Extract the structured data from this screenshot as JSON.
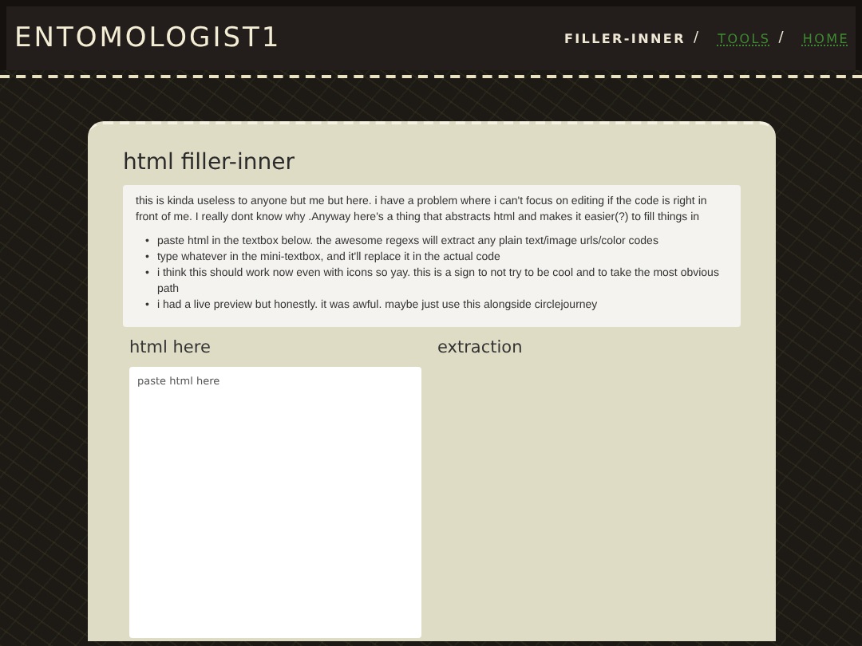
{
  "site_title": "ENTOMOLOGIST1",
  "nav": [
    {
      "label": "FILLER-INNER",
      "selected": true
    },
    {
      "label": "TOOLS",
      "selected": false
    },
    {
      "label": "HOME",
      "selected": false
    }
  ],
  "nav_separator": "/",
  "bullet_marker": "•",
  "page_title": "html filler-inner",
  "intro": "this is kinda useless to anyone but me but here. i have a problem where i can't focus on editing if the code is right in front of me. I really dont know why .Anyway here's a thing that abstracts html and makes it easier(?) to fill things in",
  "bullets": [
    "paste html in the textbox below. the awesome regexs will extract any plain text/image urls/color codes",
    "type whatever in the mini-textbox, and it'll replace it in the actual code",
    "i think this should work now even with icons so yay. this is a sign to not try to be cool and to take the most obvious path",
    "i had a live preview but honestly. it was awful. maybe just use this alongside circlejourney"
  ],
  "input_heading": "html here",
  "input": {
    "placeholder": "paste html here"
  },
  "output_heading": "extraction"
}
